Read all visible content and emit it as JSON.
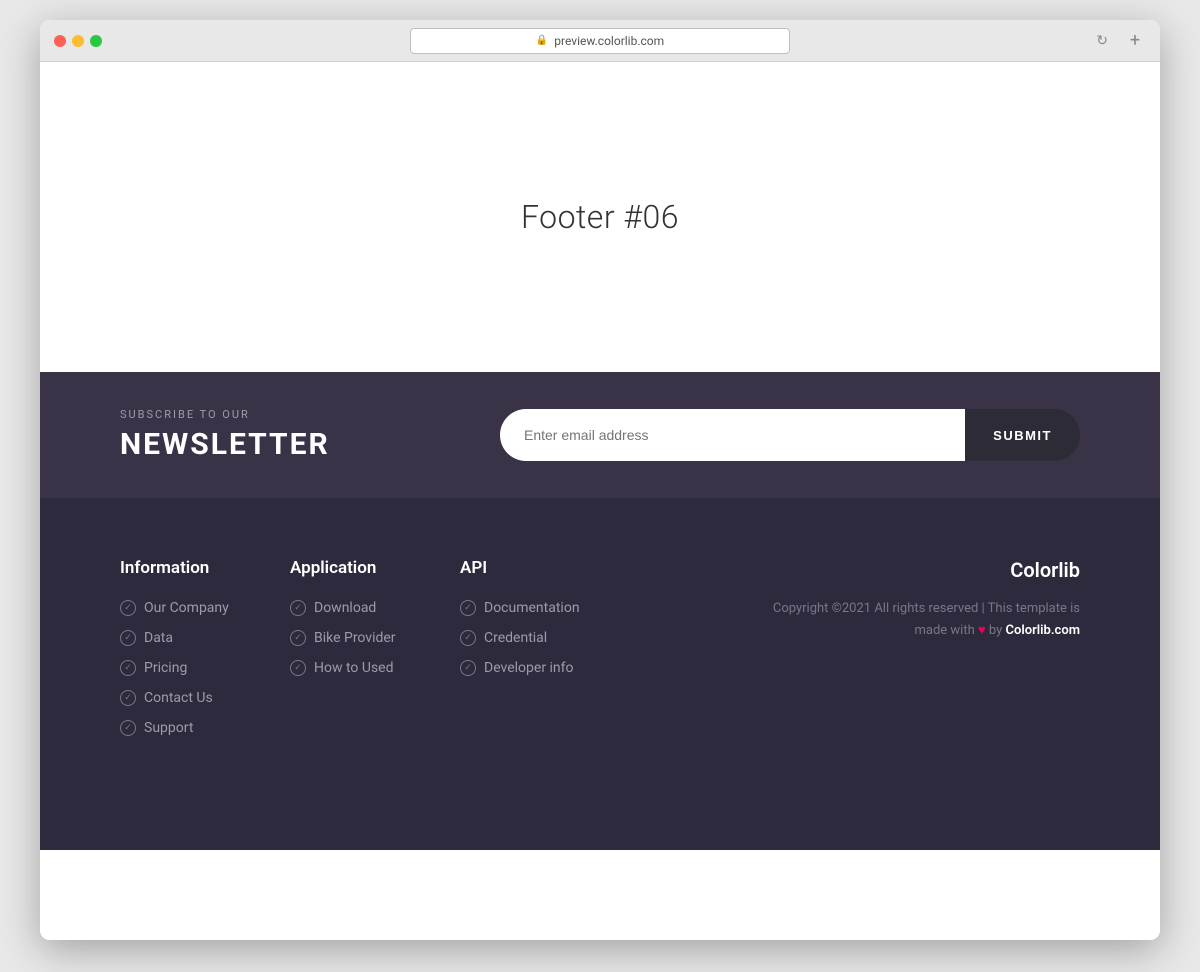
{
  "browser": {
    "address": "preview.colorlib.com",
    "new_tab_icon": "+"
  },
  "hero": {
    "title": "Footer #06"
  },
  "newsletter": {
    "subscribe_label": "SUBSCRIBE TO OUR",
    "title": "NEWSLETTER",
    "email_placeholder": "Enter email address",
    "submit_label": "SUBMIT"
  },
  "footer": {
    "col1": {
      "heading": "Information",
      "links": [
        "Our Company",
        "Data",
        "Pricing",
        "Contact Us",
        "Support"
      ]
    },
    "col2": {
      "heading": "Application",
      "links": [
        "Download",
        "Bike Provider",
        "How to Used"
      ]
    },
    "col3": {
      "heading": "API",
      "links": [
        "Documentation",
        "Credential",
        "Developer info"
      ]
    },
    "brand": {
      "name": "Colorlib",
      "copyright_line1": "Copyright ©2021 All rights reserved | This template is",
      "copyright_line2_pre": "made with ",
      "copyright_line2_mid": "♥",
      "copyright_line2_post": " by ",
      "copyright_link": "Colorlib.com"
    }
  }
}
